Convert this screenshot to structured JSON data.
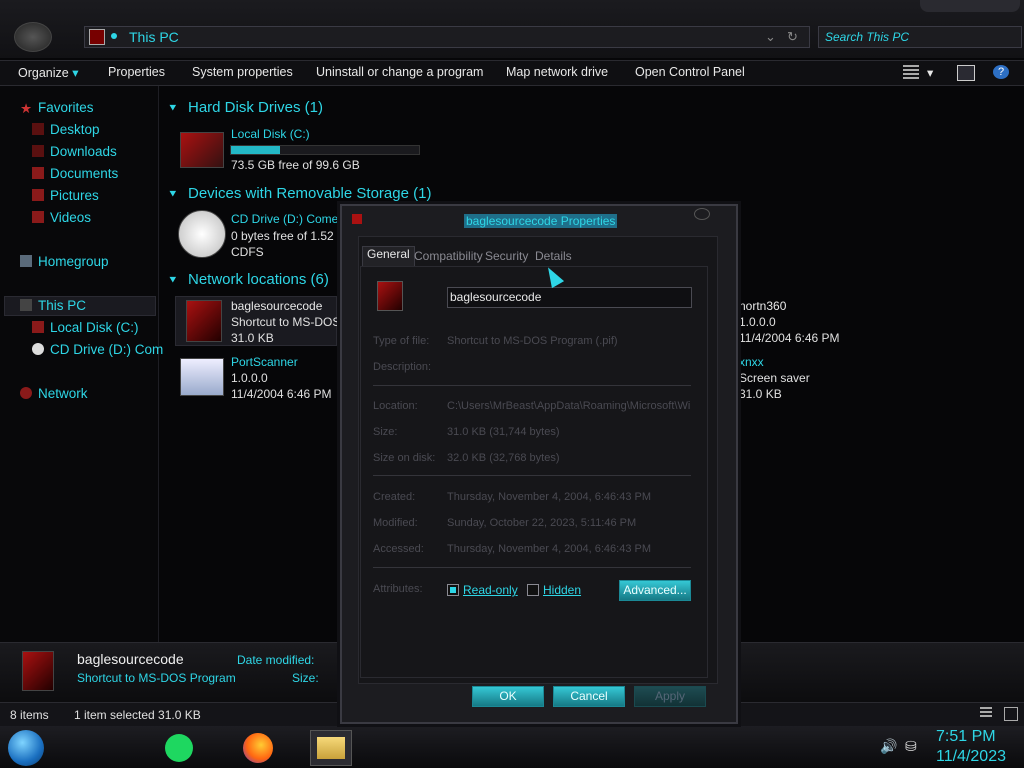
{
  "address": {
    "path": "This PC"
  },
  "search": {
    "placeholder": "Search This PC"
  },
  "toolbar": {
    "organize": "Organize",
    "properties": "Properties",
    "system_properties": "System properties",
    "uninstall": "Uninstall or change a program",
    "map_drive": "Map network drive",
    "control_panel": "Open Control Panel"
  },
  "sidebar": {
    "favorites": "Favorites",
    "desktop": "Desktop",
    "downloads": "Downloads",
    "documents": "Documents",
    "pictures": "Pictures",
    "videos": "Videos",
    "homegroup": "Homegroup",
    "this_pc": "This PC",
    "local_disk": "Local Disk (C:)",
    "cd_drive": "CD Drive (D:) Com",
    "network": "Network"
  },
  "groups": {
    "hdd": "Hard Disk Drives (1)",
    "removable": "Devices with Removable Storage (1)",
    "network": "Network locations (6)"
  },
  "items": {
    "local_disk": {
      "name": "Local Disk (C:)",
      "free": "73.5 GB free of 99.6 GB",
      "used_fraction": 0.26
    },
    "cd": {
      "name": "CD Drive (D:) Come",
      "free": "0 bytes free of 1.52",
      "fs": "CDFS"
    },
    "bagle": {
      "name": "baglesourcecode",
      "type": "Shortcut to MS-DOS",
      "size": "31.0 KB"
    },
    "portscanner": {
      "name": "PortScanner",
      "version": "1.0.0.0",
      "date": "11/4/2004 6:46 PM"
    },
    "nortn": {
      "name": "nortn360",
      "version": "1.0.0.0",
      "date": "11/4/2004 6:46 PM"
    },
    "xnxx": {
      "name": "xnxx",
      "type": "Screen saver",
      "size": "31.0 KB"
    }
  },
  "details": {
    "name": "baglesourcecode",
    "type": "Shortcut to MS-DOS Program",
    "date_label": "Date modified:",
    "size_label": "Size:"
  },
  "status": {
    "items": "8 items",
    "selected": "1 item selected  31.0 KB"
  },
  "dialog": {
    "title": "baglesourcecode Properties",
    "tabs": [
      "General",
      "Compatibility",
      "Security",
      "Details"
    ],
    "filename": "baglesourcecode",
    "rows": [
      {
        "label": "Type of file:",
        "value": "Shortcut to MS-DOS Program (.pif)"
      },
      {
        "label": "Description:",
        "value": ""
      },
      {
        "label": "Location:",
        "value": "C:\\Users\\MrBeast\\AppData\\Roaming\\Microsoft\\Wi"
      },
      {
        "label": "Size:",
        "value": "31.0 KB (31,744 bytes)"
      },
      {
        "label": "Size on disk:",
        "value": "32.0 KB (32,768 bytes)"
      },
      {
        "label": "Created:",
        "value": "Thursday, November 4, 2004, 6:46:43 PM"
      },
      {
        "label": "Modified:",
        "value": "Sunday, October 22, 2023, 5:11:46 PM"
      },
      {
        "label": "Accessed:",
        "value": "Thursday, November 4, 2004, 6:46:43 PM"
      }
    ],
    "attributes_label": "Attributes:",
    "readonly": "Read-only",
    "hidden": "Hidden",
    "advanced": "Advanced...",
    "ok": "OK",
    "cancel": "Cancel",
    "apply": "Apply"
  },
  "clock": {
    "time": "7:51 PM",
    "date": "11/4/2023"
  }
}
